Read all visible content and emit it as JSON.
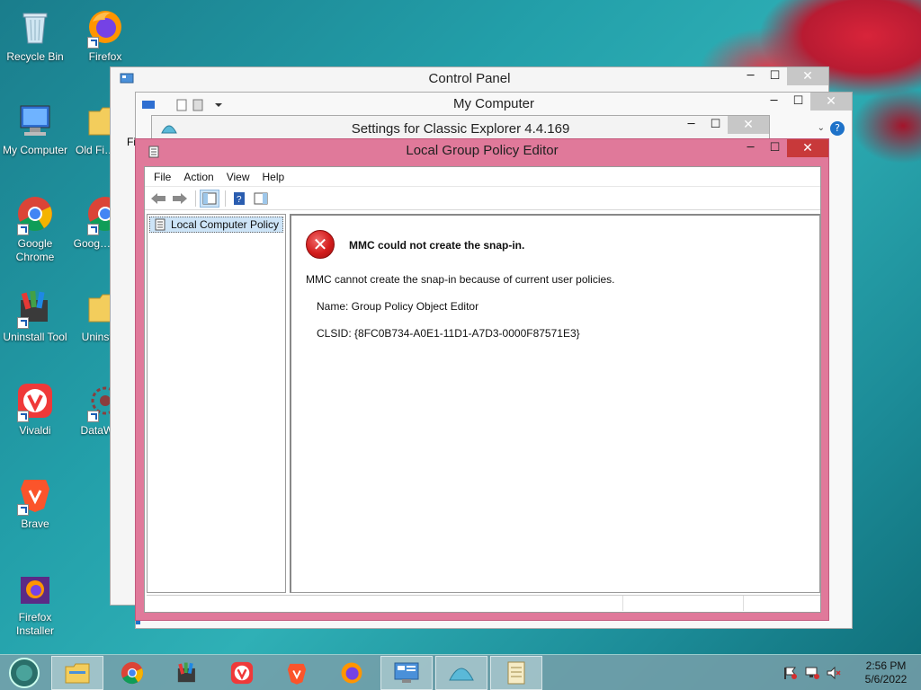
{
  "desktop": {
    "icons": [
      {
        "label": "Recycle Bin"
      },
      {
        "label": "Firefox"
      },
      {
        "label": "My Computer"
      },
      {
        "label": "Old Fi… Dat"
      },
      {
        "label": "Google Chrome"
      },
      {
        "label": "Goog… Chro"
      },
      {
        "label": "Uninstall Tool"
      },
      {
        "label": "Uninsta…"
      },
      {
        "label": "Vivaldi"
      },
      {
        "label": "DataWa…"
      },
      {
        "label": "Brave"
      },
      {
        "label": "Firefox Installer"
      }
    ]
  },
  "windows": {
    "control_panel": {
      "title": "Control Panel"
    },
    "my_computer": {
      "title": "My Computer",
      "fi_text": "Fi"
    },
    "classic_explorer": {
      "title": "Settings for Classic Explorer 4.4.169"
    },
    "group_policy": {
      "title": "Local Group Policy Editor",
      "menu": [
        "File",
        "Action",
        "View",
        "Help"
      ],
      "tree_root": "Local Computer Policy",
      "error": {
        "title": "MMC could not create the snap-in.",
        "message": "MMC cannot create the snap-in because of current user policies.",
        "name_line": "Name: Group Policy Object Editor",
        "clsid_line": "CLSID: {8FC0B734-A0E1-11D1-A7D3-0000F87571E3}"
      }
    }
  },
  "taskbar": {
    "clock": {
      "time": "2:56 PM",
      "date": "5/6/2022"
    }
  },
  "colors": {
    "accent": "#e0799a",
    "close": "#c8393a"
  }
}
